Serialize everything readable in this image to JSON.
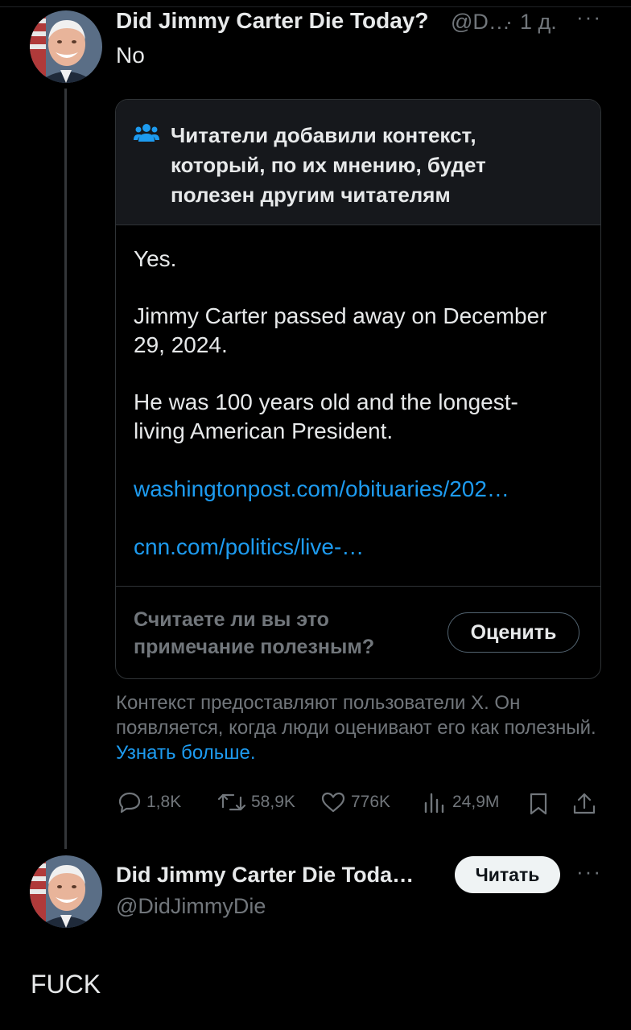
{
  "tweet1": {
    "display_name": "Did Jimmy Carter Die Today?",
    "handle": "@D…",
    "separator": "·",
    "time": "1 д.",
    "more": "···",
    "text": "No"
  },
  "community_note": {
    "title": "Читатели добавили контекст, который, по их мнению, будет полезен другим читателям",
    "paragraphs": [
      "Yes.",
      "Jimmy Carter passed away on December 29, 2024.",
      "He was 100 years old and the longest-living American President."
    ],
    "links": [
      "washingtonpost.com/obituaries/202…",
      "cnn.com/politics/live-…"
    ],
    "rate_question": "Считаете ли вы это примечание полезным?",
    "rate_button": "Оценить"
  },
  "context_info": {
    "text": "Контекст предоставляют пользователи X. Он появляется, когда люди оценивают его как полезный.",
    "learn_more": "Узнать больше."
  },
  "actions": {
    "replies": "1,8K",
    "reposts": "58,9K",
    "likes": "776K",
    "views": "24,9M"
  },
  "tweet2": {
    "display_name": "Did Jimmy Carter Die Toda…",
    "handle": "@DidJimmyDie",
    "follow_button": "Читать",
    "more": "···",
    "text": "FUCK"
  },
  "colors": {
    "background": "#000000",
    "text_primary": "#e7e9ea",
    "text_secondary": "#71767b",
    "link": "#1d9bf0",
    "card_header": "#16181c",
    "border": "#2f3336"
  }
}
